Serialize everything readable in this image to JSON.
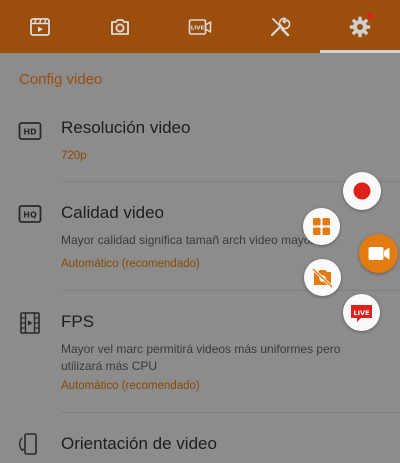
{
  "tabs": [
    {
      "icon": "video-list-icon"
    },
    {
      "icon": "camera-icon"
    },
    {
      "icon": "live-icon"
    },
    {
      "icon": "tools-icon"
    },
    {
      "icon": "settings-gear-icon",
      "selected": true,
      "has_notification": true
    }
  ],
  "section_title": "Config video",
  "settings": [
    {
      "icon": "hd-icon",
      "title": "Resolución video",
      "value": "720p"
    },
    {
      "icon": "hq-icon",
      "title": "Calidad video",
      "description": "Mayor calidad significa tamañ arch video mayor",
      "value": "Automático (recomendado)"
    },
    {
      "icon": "film-icon",
      "title": "FPS",
      "description": "Mayor vel marc permitirá videos más uniformes pero utilizará más CPU",
      "value": "Automático (recomendado)"
    },
    {
      "icon": "screen-rotation-icon",
      "title": "Orientación de video"
    }
  ],
  "floating_menu": {
    "items": [
      "record-icon",
      "apps-grid-icon",
      "camera-recorder-icon",
      "screenshot-icon",
      "live-stream-icon"
    ],
    "live_badge": "LIVE"
  },
  "colors": {
    "topbar": "#9c4e0c",
    "accent": "#e27b10",
    "record_red": "#e0201a",
    "overlay_bg": "#8c8c8c"
  }
}
